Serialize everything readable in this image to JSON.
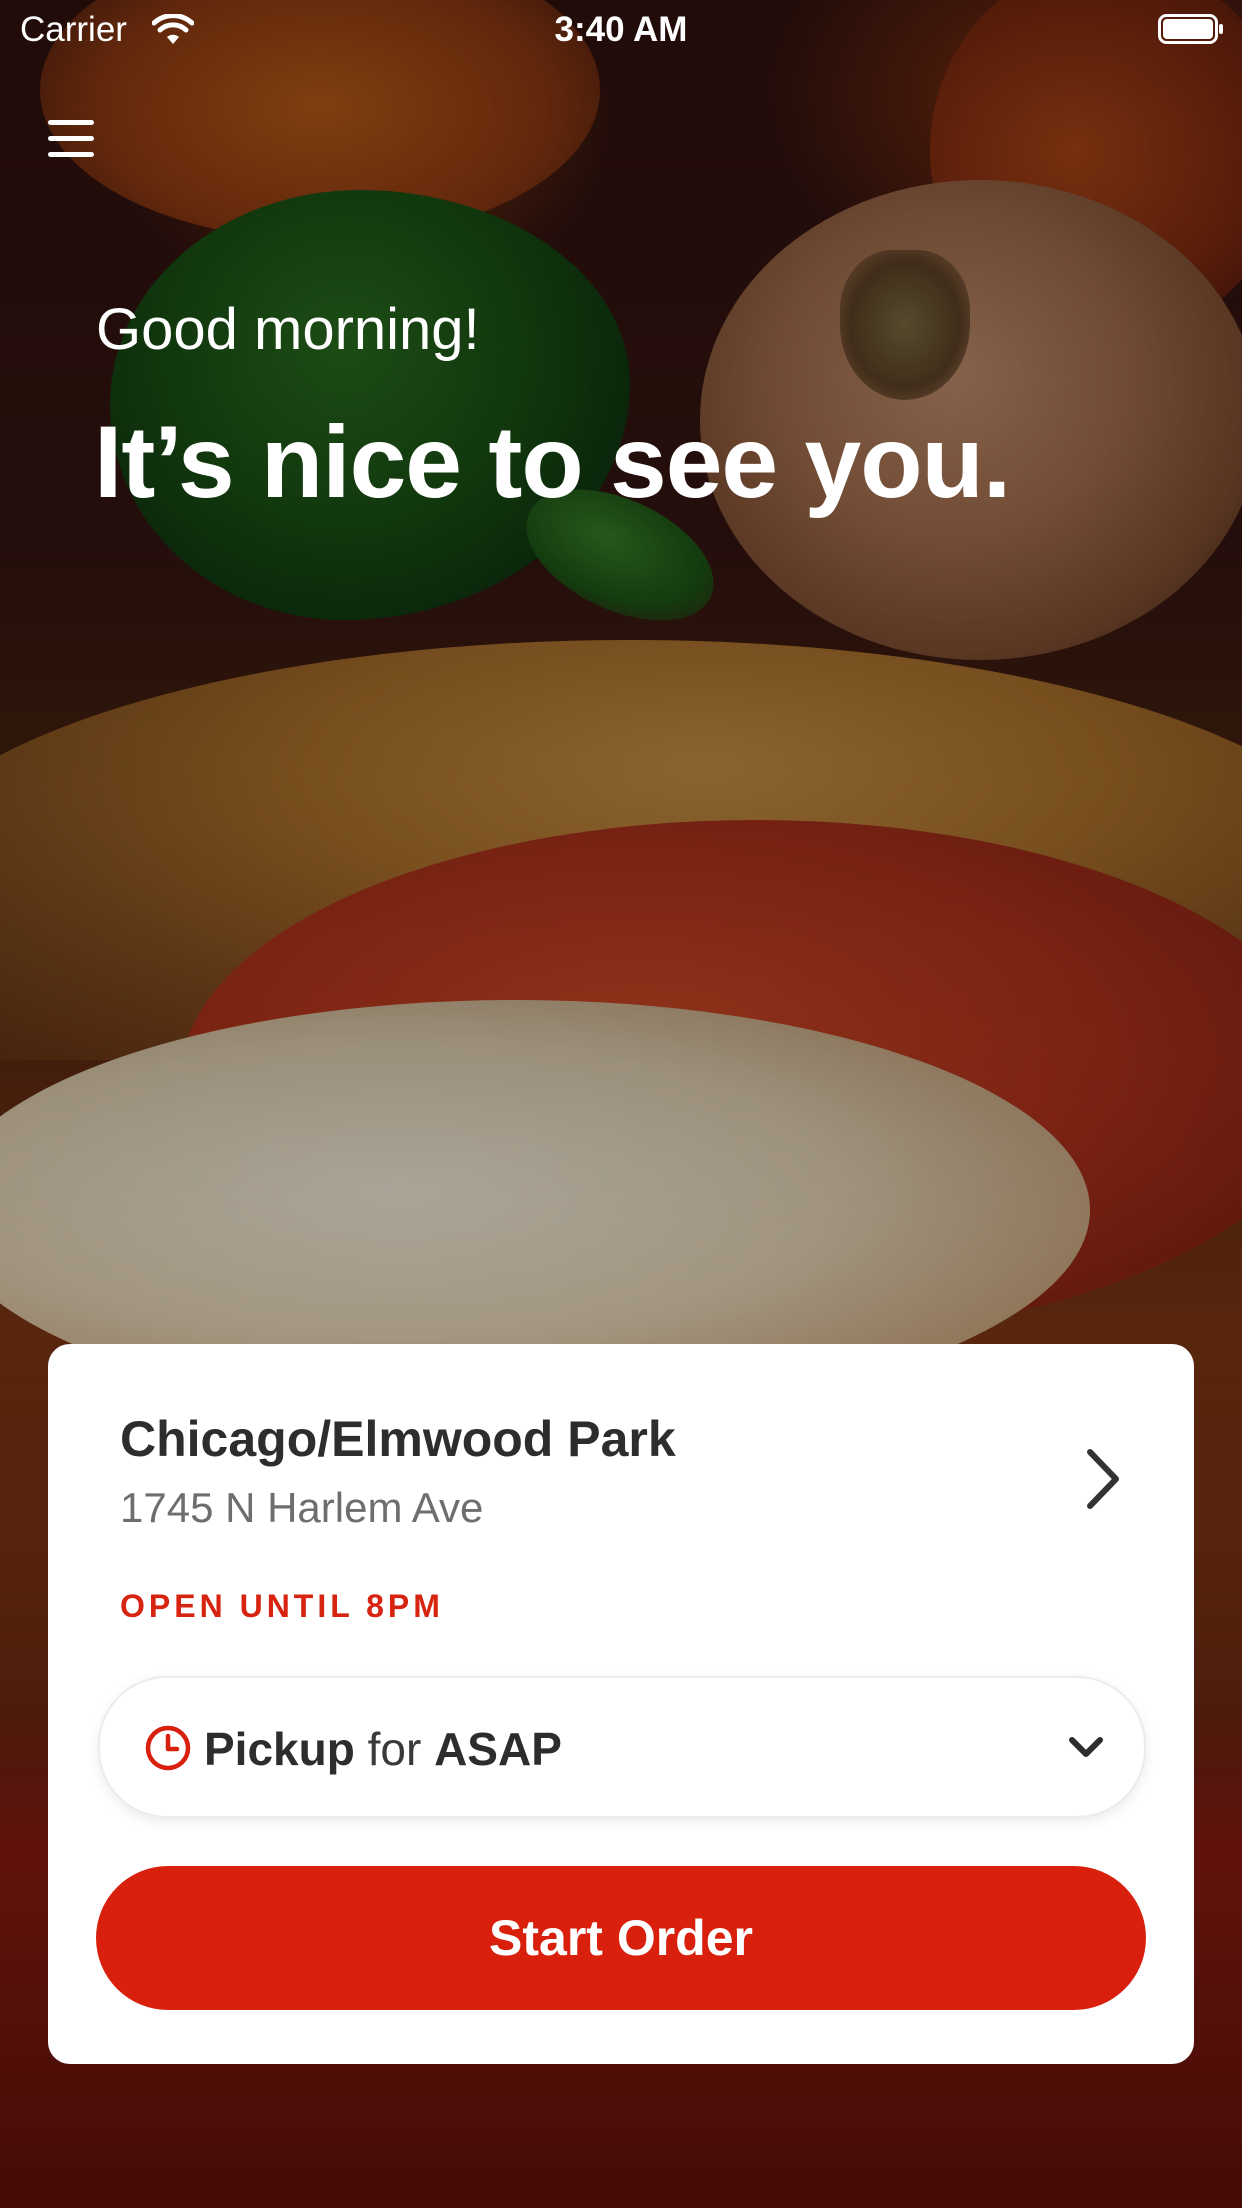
{
  "status_bar": {
    "carrier": "Carrier",
    "time": "3:40 AM"
  },
  "hero": {
    "greeting": "Good morning!",
    "headline": "It’s nice to see you."
  },
  "store_card": {
    "name": "Chicago/Elmwood Park",
    "address": "1745 N Harlem Ave",
    "hours": "OPEN UNTIL 8PM",
    "order_mode": "Pickup",
    "order_connector": "for",
    "order_time": "ASAP",
    "start_button": "Start Order"
  },
  "colors": {
    "accent": "#d8200c",
    "hours_text": "#d62410",
    "card_bg": "#ffffff",
    "title_text": "#2d2d2d",
    "secondary_text": "#6e6e6e"
  },
  "icons": {
    "menu": "hamburger-menu-icon",
    "store_link": "chevron-right-icon",
    "order_time": "clock-icon",
    "dropdown": "chevron-down-icon",
    "wifi": "wifi-icon",
    "battery": "battery-icon"
  }
}
